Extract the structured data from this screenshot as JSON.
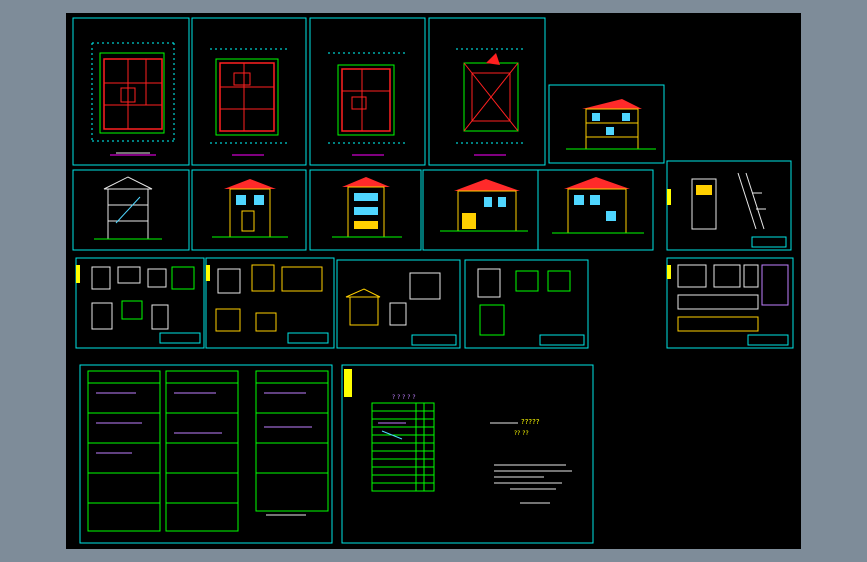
{
  "colors": {
    "frame": "#00e5e5",
    "plan_line": "#00ff00",
    "wall": "#ff2020",
    "dim": "#00ffff",
    "roof": "#ff2a2a",
    "facade": "#ffd000",
    "window": "#4fd6ff",
    "text": "#e8e8e8",
    "highlight": "#ffff00",
    "table_line": "#00ff00",
    "table_text": "#c080ff",
    "background": "#000000",
    "outer": "#7e8c99"
  },
  "cover_sheet": {
    "title_mark": "?????",
    "subtitle_mark": "?? ??",
    "table_heading": "? ? ? ? ?"
  }
}
